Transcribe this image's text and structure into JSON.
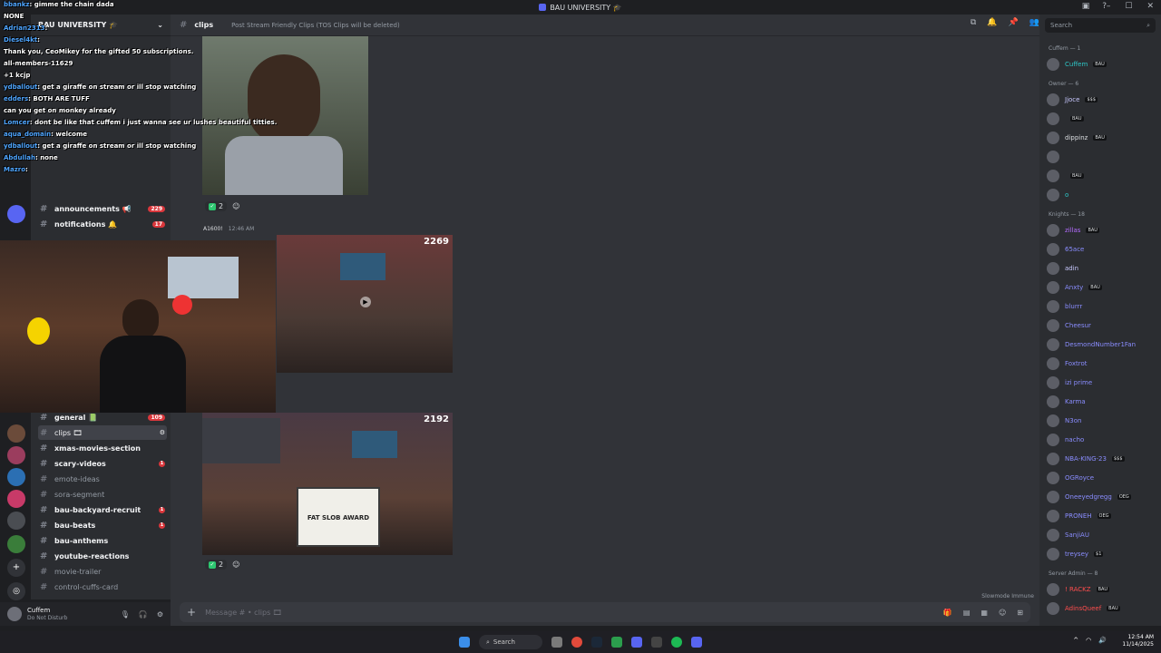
{
  "window": {
    "title": "BAU UNIVERSITY 🎓"
  },
  "header": {
    "channel_name": "clips",
    "topic": "Post Stream Friendly Clips (TOS Clips will be deleted)",
    "search_placeholder": "Search"
  },
  "guild": {
    "name": "BAU UNIVERSITY 🎓"
  },
  "channels": [
    {
      "name": "announcements 📢",
      "count": "229",
      "unread": true
    },
    {
      "name": "notifications 🔔",
      "count": "17",
      "unread": true
    },
    {
      "name": "general 📗",
      "count": "109",
      "unread": true
    },
    {
      "name": "clips 🎞",
      "active": true
    },
    {
      "name": "xmas-movies-section",
      "unread": true
    },
    {
      "name": "scary-videos",
      "dot": "1",
      "unread": true
    },
    {
      "name": "emote-ideas"
    },
    {
      "name": "sora-segment"
    },
    {
      "name": "bau-backyard-recruit",
      "dot": "1",
      "unread": true
    },
    {
      "name": "bau-beats",
      "dot": "1",
      "unread": true
    },
    {
      "name": "bau-anthems",
      "unread": true
    },
    {
      "name": "youtube-reactions",
      "unread": true
    },
    {
      "name": "movie-trailer"
    },
    {
      "name": "control-cuffs-card"
    }
  ],
  "user": {
    "name": "Cuffem",
    "status": "Do Not Disturb"
  },
  "messages": [
    {
      "reaction_count": "2"
    },
    {
      "author": "A1600!",
      "time": "12:46 AM",
      "view_count_1": "2269",
      "view_count_2": "2192",
      "reaction_count": "2",
      "award_text": "FAT SLOB AWARD"
    }
  ],
  "composer": {
    "placeholder": "Message # • clips 🎞",
    "slowmode": "Slowmode Immune"
  },
  "members": {
    "groups": [
      {
        "label": "Cuffem — 1",
        "members": [
          {
            "name": "Cuffem",
            "color": "#2dc7c7",
            "tag": "BAU"
          }
        ]
      },
      {
        "label": "Owner — 6",
        "members": [
          {
            "name": "Jjoce",
            "color": "#c8c8ff",
            "tag": "$$$"
          },
          {
            "name": "",
            "color": "#b36bff",
            "tag": "BAU"
          },
          {
            "name": "dippinz",
            "color": "#dbdee1",
            "tag": "BAU"
          },
          {
            "name": "",
            "color": "#dbdee1",
            "tag": ""
          },
          {
            "name": "",
            "color": "#dbdee1",
            "tag": "BAU"
          },
          {
            "name": "o",
            "color": "#2dc7c7",
            "tag": ""
          }
        ]
      },
      {
        "label": "Knights — 18",
        "members": [
          {
            "name": "zillas",
            "color": "#b36bff",
            "tag": "BAU"
          },
          {
            "name": "65ace",
            "color": "#8a8dff",
            "tag": ""
          },
          {
            "name": "adin",
            "color": "#c8c8ff",
            "tag": ""
          },
          {
            "name": "Anxty",
            "color": "#8a8dff",
            "tag": "BAU"
          },
          {
            "name": "blurrr",
            "color": "#8a8dff",
            "tag": ""
          },
          {
            "name": "Cheesur",
            "color": "#8a8dff",
            "tag": ""
          },
          {
            "name": "DesmondNumber1Fan",
            "color": "#8a8dff",
            "tag": ""
          },
          {
            "name": "Foxtrot",
            "color": "#8a8dff",
            "tag": ""
          },
          {
            "name": "izi prime",
            "color": "#8a8dff",
            "tag": ""
          },
          {
            "name": "Karma",
            "color": "#8a8dff",
            "tag": ""
          },
          {
            "name": "N3on",
            "color": "#8a8dff",
            "tag": ""
          },
          {
            "name": "nacho",
            "color": "#8a8dff",
            "tag": ""
          },
          {
            "name": "NBA-KING-23",
            "color": "#8a8dff",
            "tag": "$$$"
          },
          {
            "name": "OGRoyce",
            "color": "#8a8dff",
            "tag": ""
          },
          {
            "name": "Oneeyedgregg",
            "color": "#8a8dff",
            "tag": "OEG"
          },
          {
            "name": "PRONEH",
            "color": "#8a8dff",
            "tag": "OEG"
          },
          {
            "name": "SanjiAU",
            "color": "#8a8dff",
            "tag": ""
          },
          {
            "name": "treysey",
            "color": "#8a8dff",
            "tag": "$1"
          }
        ]
      },
      {
        "label": "Server Admin — 8",
        "members": [
          {
            "name": "! RACKZ",
            "color": "#ff4d4d",
            "tag": "BAU"
          },
          {
            "name": "AdinsQueef",
            "color": "#ff4d4d",
            "tag": "BAU"
          }
        ]
      }
    ]
  },
  "overlay_chat": [
    {
      "user": "bbankz",
      "text": "gimme the chain dada"
    },
    {
      "user": "",
      "text": "NONE"
    },
    {
      "user": "Adrian2313",
      "text": ""
    },
    {
      "user": "Diesel4kt",
      "text": ""
    },
    {
      "user": "",
      "text": "Thank you, CeoMikey for the gifted 50 subscriptions."
    },
    {
      "user": "",
      "text": "all-members-11629"
    },
    {
      "user": "",
      "text": "+1 kcjp"
    },
    {
      "user": "ydballout",
      "text": "get a giraffe on stream or ill stop watching"
    },
    {
      "user": "edders",
      "text": "BOTH ARE TUFF"
    },
    {
      "user": "",
      "text": "can you get on monkey already"
    },
    {
      "user": "Lomcer",
      "text": "dont be like that cuffem i just wanna see ur lushes beautiful titties."
    },
    {
      "user": "aqua_domain",
      "text": "welcome"
    },
    {
      "user": "ydballout",
      "text": "get a giraffe on stream or ill stop watching"
    },
    {
      "user": "Abdullah",
      "text": "none"
    },
    {
      "user": "Mazro",
      "text": ""
    }
  ],
  "taskbar": {
    "search": "Search",
    "time": "12:54 AM",
    "date": "11/14/2025"
  }
}
